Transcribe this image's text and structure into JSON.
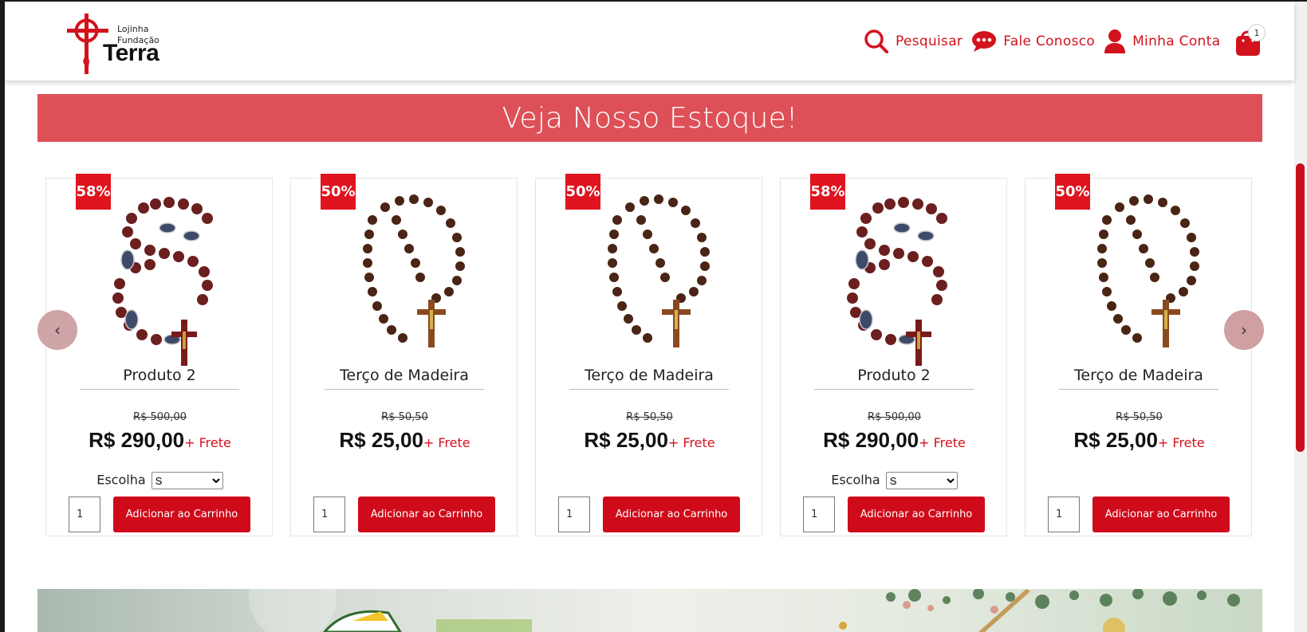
{
  "brand": {
    "line1": "Lojinha",
    "line2": "Fundação",
    "name": "Terra",
    "accent": "#d2121d"
  },
  "nav": {
    "search": "Pesquisar",
    "contact": "Fale Conosco",
    "account": "Minha Conta",
    "cart_count": "1"
  },
  "banner": {
    "title": "Veja Nosso Estoque!"
  },
  "products": [
    {
      "discount": "58%",
      "name": "Produto 2",
      "old_price": "R$ 500,00",
      "price": "R$ 290,00",
      "frete": "+ Frete",
      "variant_label": "Escolha",
      "variant_value": "S",
      "qty": "1",
      "button": "Adicionar ao Carrinho"
    },
    {
      "discount": "50%",
      "name": "Terço de Madeira",
      "old_price": "R$ 50,50",
      "price": "R$ 25,00",
      "frete": "+ Frete",
      "qty": "1",
      "button": "Adicionar ao Carrinho"
    },
    {
      "discount": "50%",
      "name": "Terço de Madeira",
      "old_price": "R$ 50,50",
      "price": "R$ 25,00",
      "frete": "+ Frete",
      "qty": "1",
      "button": "Adicionar ao Carrinho"
    },
    {
      "discount": "58%",
      "name": "Produto 2",
      "old_price": "R$ 500,00",
      "price": "R$ 290,00",
      "frete": "+ Frete",
      "variant_label": "Escolha",
      "variant_value": "S",
      "qty": "1",
      "button": "Adicionar ao Carrinho"
    },
    {
      "discount": "50%",
      "name": "Terço de Madeira",
      "old_price": "R$ 50,50",
      "price": "R$ 25,00",
      "frete": "+ Frete",
      "qty": "1",
      "button": "Adicionar ao Carrinho"
    }
  ],
  "carousel": {
    "prev_icon": "chevron-left-icon",
    "next_icon": "chevron-right-icon",
    "prev_glyph": "‹",
    "next_glyph": "›"
  }
}
